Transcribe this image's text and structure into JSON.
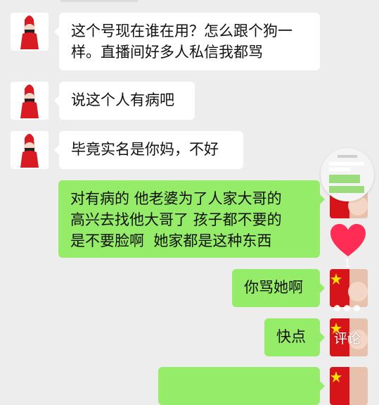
{
  "messages": [
    {
      "side": "in",
      "text": "这个号现在谁在用？怎么跟个狗一\n样。直播间好多人私信我都骂"
    },
    {
      "side": "in",
      "text": "说这个人有病吧"
    },
    {
      "side": "in",
      "text": "毕竟实名是你妈，不好"
    },
    {
      "side": "out",
      "text": "对有病的 他老婆为了人家大哥的\n高兴去找他大哥了 孩子都不要的\n是不要脸啊  她家都是这种东西"
    },
    {
      "side": "out",
      "text": "你骂她啊"
    },
    {
      "side": "out",
      "text": "快点"
    }
  ],
  "overlay": {
    "like_count": "1",
    "comment_label": "评论"
  },
  "colors": {
    "background": "#ededed",
    "incoming_bubble": "#ffffff",
    "outgoing_bubble": "#95ec69",
    "heart": "#ff2d55"
  }
}
